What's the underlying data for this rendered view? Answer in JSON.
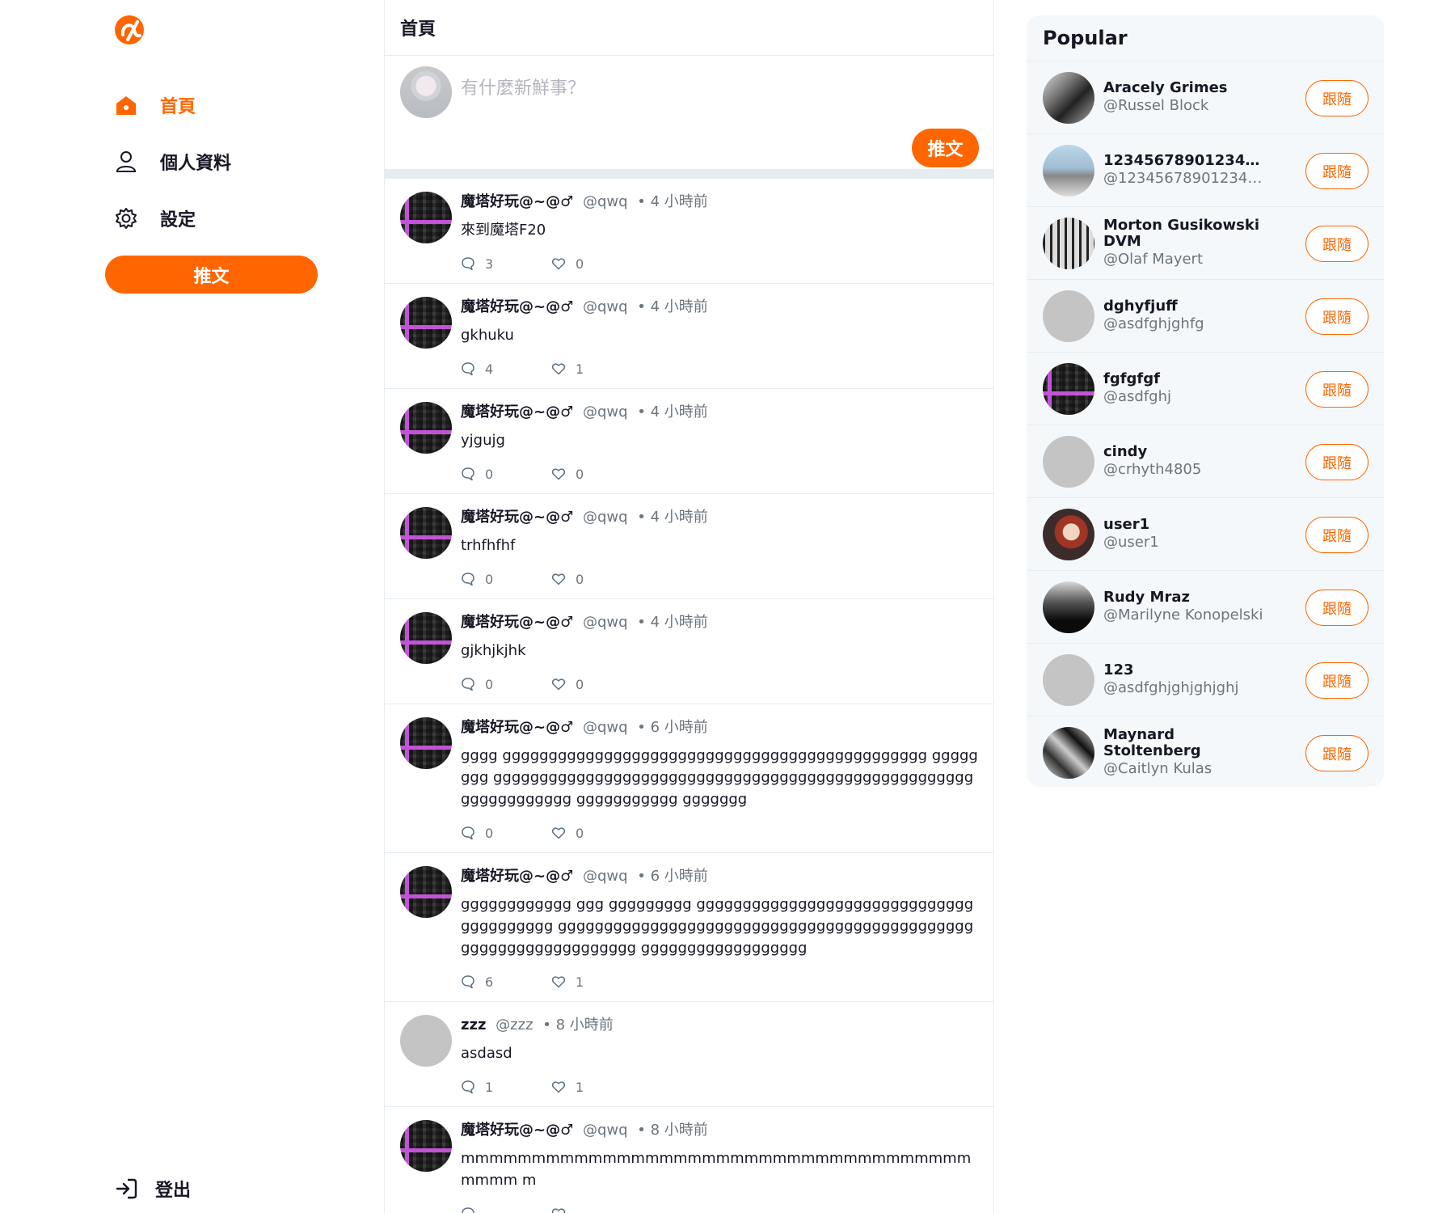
{
  "sidebar": {
    "nav": [
      {
        "label": "首頁",
        "icon": "home-icon",
        "active": true
      },
      {
        "label": "個人資料",
        "icon": "user-icon",
        "active": false
      },
      {
        "label": "設定",
        "icon": "gear-icon",
        "active": false
      }
    ],
    "tweet_button": "推文",
    "logout_label": "登出"
  },
  "main": {
    "title": "首頁",
    "compose": {
      "placeholder": "有什麼新鮮事？",
      "button": "推文"
    },
    "tweets": [
      {
        "name": "魔塔好玩@~@♂",
        "handle": "@qwq",
        "time": "• 4 小時前",
        "body": "來到魔塔F20",
        "replies": "3",
        "likes": "0"
      },
      {
        "name": "魔塔好玩@~@♂",
        "handle": "@qwq",
        "time": "• 4 小時前",
        "body": "gkhuku",
        "replies": "4",
        "likes": "1"
      },
      {
        "name": "魔塔好玩@~@♂",
        "handle": "@qwq",
        "time": "• 4 小時前",
        "body": "yjgujg",
        "replies": "0",
        "likes": "0"
      },
      {
        "name": "魔塔好玩@~@♂",
        "handle": "@qwq",
        "time": "• 4 小時前",
        "body": "trhfhfhf",
        "replies": "0",
        "likes": "0"
      },
      {
        "name": "魔塔好玩@~@♂",
        "handle": "@qwq",
        "time": "• 4 小時前",
        "body": "gjkhjkjhk",
        "replies": "0",
        "likes": "0"
      },
      {
        "name": "魔塔好玩@~@♂",
        "handle": "@qwq",
        "time": "• 6 小時前",
        "body": "gggg gggggggggggggggggggggggggggggggggggggggggggggg gggggggg gggggggggggggggggggggggggggggggggggggggggggggggggggggggggggggggg ggggggggggg ggggggg",
        "replies": "0",
        "likes": "0"
      },
      {
        "name": "魔塔好玩@~@♂",
        "handle": "@qwq",
        "time": "• 6 小時前",
        "body": "gggggggggggg ggg ggggggggg gggggggggggggggggggggggggggggggggggggggg gggggggggggggggggggggggggggggggggggggggggggggggggggggggggggggggg gggggggggggggggggg",
        "replies": "6",
        "likes": "1"
      },
      {
        "name": "zzz",
        "handle": "@zzz",
        "time": "• 8 小時前",
        "body": "asdasd",
        "replies": "1",
        "likes": "1"
      },
      {
        "name": "魔塔好玩@~@♂",
        "handle": "@qwq",
        "time": "• 8 小時前",
        "body": "mmmmmmmmmmmmmmmmmmmmmmmmmmmmmmmmmmmmmmmm m",
        "replies": "",
        "likes": ""
      }
    ]
  },
  "popular": {
    "title": "Popular",
    "follow_label": "跟隨",
    "users": [
      {
        "name": "Aracely Grimes",
        "handle": "@Russel Block"
      },
      {
        "name": "12345678901234567...",
        "handle": "@123456789012345..."
      },
      {
        "name": "Morton Gusikowski DVM",
        "handle": "@Olaf Mayert"
      },
      {
        "name": "dghyfjuff",
        "handle": "@asdfghjghfg"
      },
      {
        "name": "fgfgfgf",
        "handle": "@asdfghj"
      },
      {
        "name": "cindy",
        "handle": "@crhyth4805"
      },
      {
        "name": "user1",
        "handle": "@user1"
      },
      {
        "name": "Rudy Mraz",
        "handle": "@Marilyne Konopelski"
      },
      {
        "name": "123",
        "handle": "@asdfghjghjghjghj"
      },
      {
        "name": "Maynard Stoltenberg",
        "handle": "@Caitlyn Kulas"
      }
    ]
  },
  "colors": {
    "accent": "#ff6600",
    "text": "#171725",
    "muted": "#6c757d",
    "divider": "#e6ecf0",
    "panel": "#f5f8fa"
  }
}
